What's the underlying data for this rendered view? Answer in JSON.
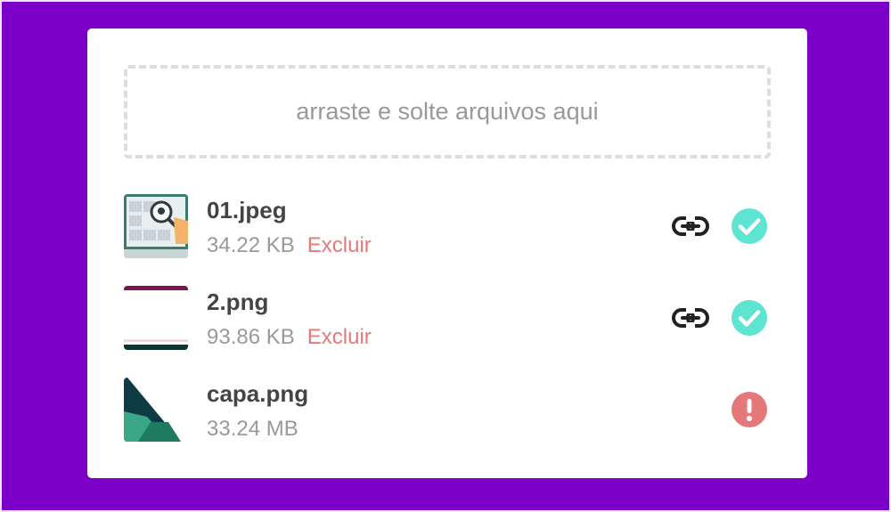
{
  "dropzone": {
    "text": "arraste e solte arquivos aqui"
  },
  "files": [
    {
      "name": "01.jpeg",
      "size": "34.22 KB",
      "delete_label": "Excluir",
      "status": "success"
    },
    {
      "name": "2.png",
      "size": "93.86 KB",
      "delete_label": "Excluir",
      "status": "success"
    },
    {
      "name": "capa.png",
      "size": "33.24 MB",
      "status": "error"
    }
  ],
  "colors": {
    "background": "#7d00c8",
    "card": "#ffffff",
    "success": "#5ee5d2",
    "error": "#e57878",
    "delete": "#e57878"
  }
}
